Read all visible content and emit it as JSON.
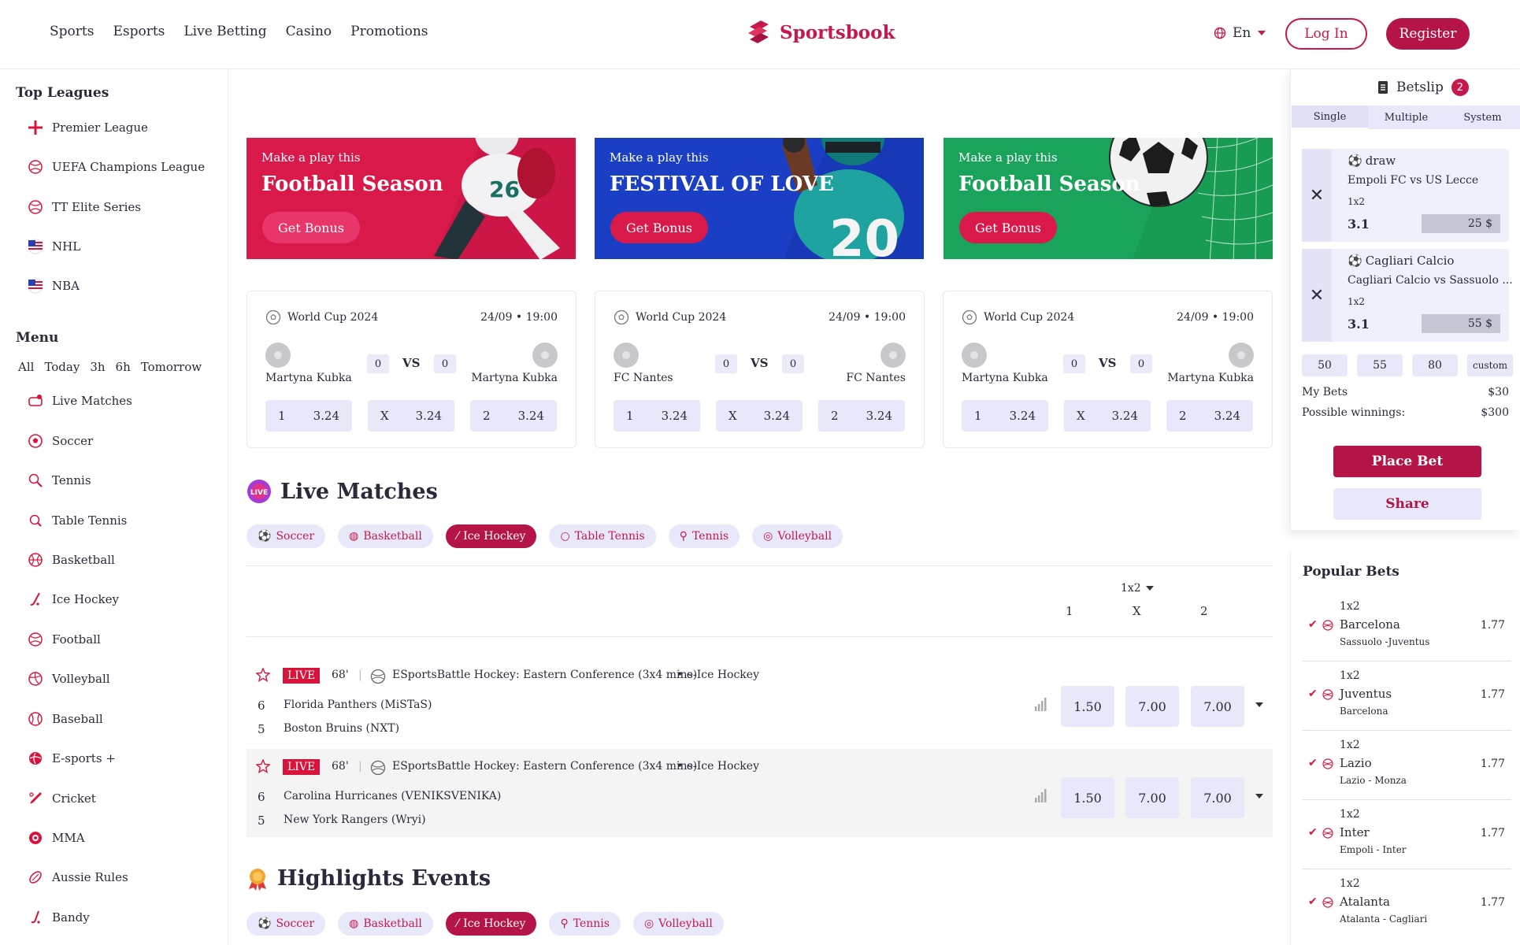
{
  "header": {
    "nav": [
      "Sports",
      "Esports",
      "Live Betting",
      "Casino",
      "Promotions"
    ],
    "brand": "Sportsbook",
    "language": "En",
    "login_label": "Log In",
    "register_label": "Register"
  },
  "sidebar": {
    "top_leagues_title": "Top Leagues",
    "top_leagues": [
      "Premier League",
      "UEFA Champions League",
      "TT Elite Series",
      "NHL",
      "NBA"
    ],
    "menu_title": "Menu",
    "time_filters": [
      "All",
      "Today",
      "3h",
      "6h",
      "Tomorrow"
    ],
    "menu_items": [
      "Live Matches",
      "Soccer",
      "Tennis",
      "Table Tennis",
      "Basketball",
      "Ice Hockey",
      "Football",
      "Volleyball",
      "Baseball",
      "E-sports +",
      "Cricket",
      "MMA",
      "Aussie Rules",
      "Bandy"
    ]
  },
  "banners": [
    {
      "kicker": "Make a play this",
      "title": "Football Season",
      "cta": "Get Bonus",
      "color": "#d8194a"
    },
    {
      "kicker": "Make a play this",
      "title": "FESTIVAL OF LOVE",
      "cta": "Get Bonus",
      "color": "#1a3fc4"
    },
    {
      "kicker": "Make a play this",
      "title": "Football Season",
      "cta": "Get Bonus",
      "color": "#1aa35a"
    }
  ],
  "match_cards": [
    {
      "league": "World Cup 2024",
      "date": "24/09 • 19:00",
      "home": "Martyna Kubka",
      "away": "Martyna Kubka",
      "home_score": "0",
      "away_score": "0",
      "vs": "VS",
      "odds": [
        [
          "1",
          "3.24"
        ],
        [
          "X",
          "3.24"
        ],
        [
          "2",
          "3.24"
        ]
      ]
    },
    {
      "league": "World Cup 2024",
      "date": "24/09 • 19:00",
      "home": "FC Nantes",
      "away": "FC Nantes",
      "home_score": "0",
      "away_score": "0",
      "vs": "VS",
      "odds": [
        [
          "1",
          "3.24"
        ],
        [
          "X",
          "3.24"
        ],
        [
          "2",
          "3.24"
        ]
      ]
    },
    {
      "league": "World Cup 2024",
      "date": "24/09 • 19:00",
      "home": "Martyna Kubka",
      "away": "Martyna Kubka",
      "home_score": "0",
      "away_score": "0",
      "vs": "VS",
      "odds": [
        [
          "1",
          "3.24"
        ],
        [
          "X",
          "3.24"
        ],
        [
          "2",
          "3.24"
        ]
      ]
    }
  ],
  "live": {
    "title": "Live Matches",
    "chips": [
      "Soccer",
      "Basketball",
      "Ice Hockey",
      "Table Tennis",
      "Tennis",
      "Volleyball"
    ],
    "active_chip": "Ice Hockey",
    "market": "1x2",
    "columns": [
      "1",
      "X",
      "2"
    ],
    "rows": [
      {
        "badge": "LIVE",
        "minute": "68'",
        "league": "ESportsBattle Hockey: Eastern Conference (3x4 mins)",
        "sport": "• e-Ice Hockey",
        "team1_score": "6",
        "team1": "Florida Panthers (MiSTaS)",
        "team2_score": "5",
        "team2": "Boston Bruins (NXT)",
        "odds": [
          "1.50",
          "7.00",
          "7.00"
        ]
      },
      {
        "badge": "LIVE",
        "minute": "68'",
        "league": "ESportsBattle Hockey: Eastern Conference (3x4 mins)",
        "sport": "• e-Ice Hockey",
        "team1_score": "6",
        "team1": "Carolina Hurricanes (VENIKSVENIKA)",
        "team2_score": "5",
        "team2": "New York Rangers (Wryi)",
        "odds": [
          "1.50",
          "7.00",
          "7.00"
        ]
      }
    ]
  },
  "highlights": {
    "title": "Highlights Events",
    "chips": [
      "Soccer",
      "Basketball",
      "Ice Hockey",
      "Tennis",
      "Volleyball"
    ],
    "active_chip": "Ice Hockey"
  },
  "betslip": {
    "title": "Betslip",
    "count": "2",
    "tabs": [
      "Single",
      "Multiple",
      "System"
    ],
    "active_tab": "Single",
    "bets": [
      {
        "type": "draw",
        "match": "Empoli FC vs US Lecce",
        "market": "1x2",
        "odd": "3.1",
        "stake": "25 $"
      },
      {
        "type": "Cagliari Calcio",
        "match": "Cagliari Calcio vs Sassuolo ...",
        "market": "1x2",
        "odd": "3.1",
        "stake": "55 $"
      }
    ],
    "quick_stakes": [
      "50",
      "55",
      "80",
      "custom"
    ],
    "my_bets_label": "My Bets",
    "my_bets_value": "$30",
    "winnings_label": "Possible winnings:",
    "winnings_value": "$300",
    "place_label": "Place Bet",
    "share_label": "Share"
  },
  "popular": {
    "title": "Popular Bets",
    "items": [
      {
        "market": "1x2",
        "team": "Barcelona",
        "match": "Sassuolo -Juventus",
        "odd": "1.77"
      },
      {
        "market": "1x2",
        "team": "Juventus",
        "match": "Barcelona",
        "odd": "1.77"
      },
      {
        "market": "1x2",
        "team": "Lazio",
        "match": "Lazio - Monza",
        "odd": "1.77"
      },
      {
        "market": "1x2",
        "team": "Inter",
        "match": "Empoli - Inter",
        "odd": "1.77"
      },
      {
        "market": "1x2",
        "team": "Atalanta",
        "match": "Atalanta - Cagliari",
        "odd": "1.77"
      }
    ]
  },
  "colors": {
    "brand": "#c8174d",
    "brand_dark": "#b41446",
    "pill": "#e7e8f9",
    "live": "#d8143c"
  }
}
